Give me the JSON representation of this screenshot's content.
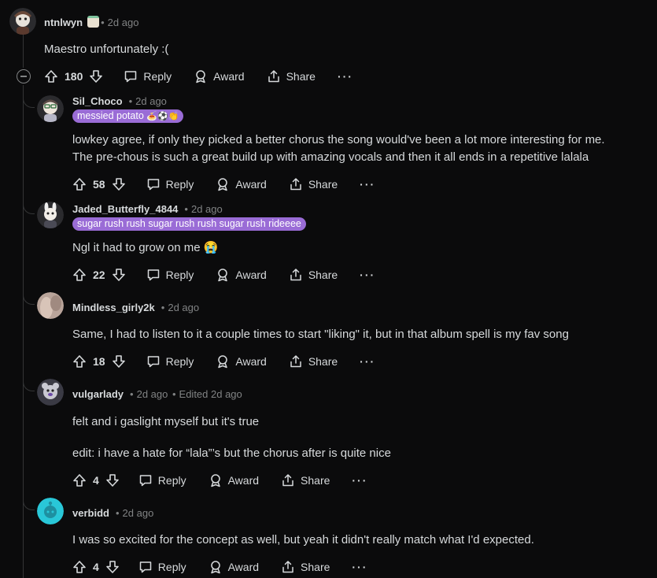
{
  "colors": {
    "background": "#0b0b0c",
    "text": "#d7dadc",
    "muted": "#818384",
    "flair": "#9a6cd6",
    "thread": "#343536"
  },
  "labels": {
    "reply": "Reply",
    "award": "Award",
    "share": "Share",
    "more": "···"
  },
  "comments": [
    {
      "username": "ntnlwyn",
      "has_badge": true,
      "time": "2d ago",
      "flair": "",
      "lines": [
        "Maestro unfortunately :("
      ],
      "votes": "180",
      "avatar_color": "#6b4a3a"
    },
    {
      "username": "Sil_Choco",
      "time": "2d ago",
      "flair": "messied potato",
      "flair_emoji": "🍝⚽👏",
      "lines": [
        "lowkey agree, if only they picked a better chorus the song would've been a lot more interesting for me.",
        "The pre-chous is such a great build up with amazing vocals and then it all ends in a repetitive lalala"
      ],
      "votes": "58",
      "avatar_color": "#5a4a45"
    },
    {
      "username": "Jaded_Butterfly_4844",
      "time": "2d ago",
      "flair": "sugar rush rush sugar rush rush sugar rush rideeee",
      "lines": [
        "Ngl it had to grow on me 😭"
      ],
      "votes": "22",
      "avatar_color": "#4a4a55"
    },
    {
      "username": "Mindless_girly2k",
      "time": "2d ago",
      "flair": "",
      "lines": [
        "Same, I had to listen to it a couple times to start \"liking\" it, but in that album spell is my fav song"
      ],
      "votes": "18",
      "avatar_color": "#b9a49a"
    },
    {
      "username": "vulgarlady",
      "time": "2d ago",
      "edited": "Edited 2d ago",
      "flair": "",
      "lines": [
        "felt and i gaslight myself but it's true",
        "edit: i have a hate for “lala”’s but the chorus after is quite nice"
      ],
      "votes": "4",
      "avatar_color": "#3a3a44"
    },
    {
      "username": "verbidd",
      "time": "2d ago",
      "flair": "",
      "lines": [
        "I was so excited for the concept as well, but yeah it didn't really match what I'd expected."
      ],
      "votes": "4",
      "avatar_color": "#29c7d8"
    }
  ]
}
